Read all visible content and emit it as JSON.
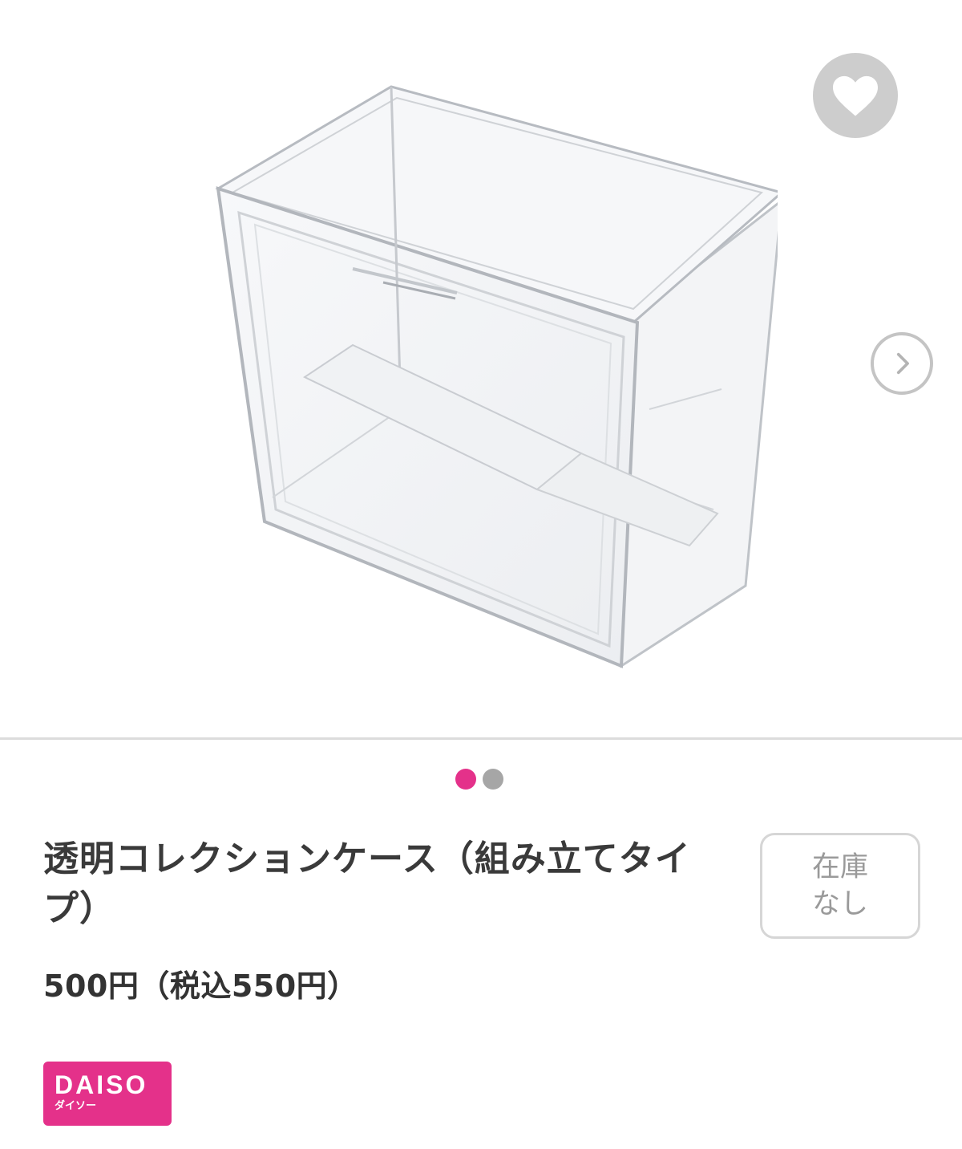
{
  "gallery": {
    "image_alt": "透明コレクションケース（組み立てタイプ）",
    "favorite_icon": "heart-icon",
    "next_icon": "chevron-right-icon",
    "dots": [
      {
        "active": true
      },
      {
        "active": false
      }
    ]
  },
  "product": {
    "title": "透明コレクションケース（組み立てタイプ）",
    "price": "500円（税込550円）",
    "stock_line1": "在庫",
    "stock_line2": "なし"
  },
  "brand": {
    "logo_text": "DAISO",
    "logo_subtext": "ダイソー"
  },
  "colors": {
    "accent": "#e4318a",
    "dot_inactive": "#a6a6a6",
    "favorite_bg": "#cdcdcd"
  }
}
